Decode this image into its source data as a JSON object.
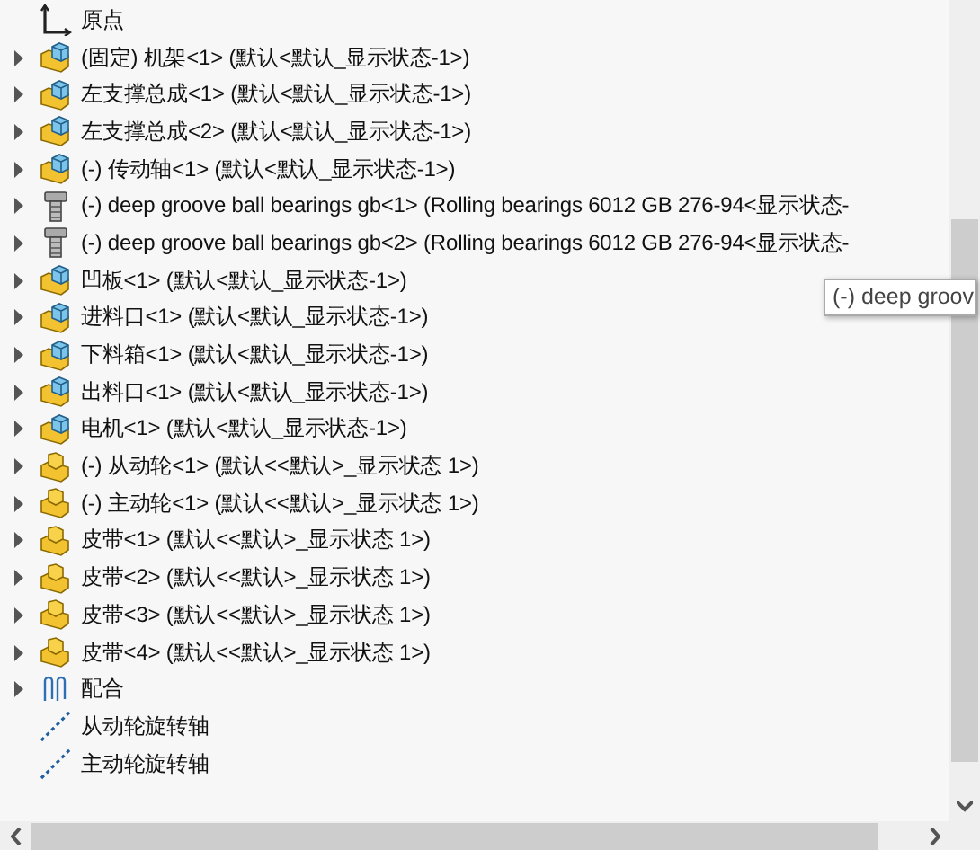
{
  "tree": [
    {
      "kind": "origin",
      "label": "原点"
    },
    {
      "kind": "subassembly",
      "label": "(固定) 机架<1> (默认<默认_显示状态-1>)",
      "expanded": false
    },
    {
      "kind": "subassembly",
      "label": "左支撑总成<1> (默认<默认_显示状态-1>)",
      "expanded": false
    },
    {
      "kind": "subassembly",
      "label": "左支撑总成<2> (默认<默认_显示状态-1>)",
      "expanded": false
    },
    {
      "kind": "subassembly",
      "label": "(-) 传动轴<1> (默认<默认_显示状态-1>)",
      "expanded": false
    },
    {
      "kind": "fastener",
      "label": "(-) deep groove ball bearings gb<1> (Rolling bearings 6012 GB 276-94<显示状态-",
      "expanded": false
    },
    {
      "kind": "fastener",
      "label": "(-) deep groove ball bearings gb<2> (Rolling bearings 6012 GB 276-94<显示状态-",
      "expanded": false
    },
    {
      "kind": "subassembly",
      "label": "凹板<1> (默认<默认_显示状态-1>)",
      "expanded": false
    },
    {
      "kind": "subassembly",
      "label": "进料口<1> (默认<默认_显示状态-1>)",
      "expanded": false
    },
    {
      "kind": "subassembly",
      "label": "下料箱<1> (默认<默认_显示状态-1>)",
      "expanded": false
    },
    {
      "kind": "subassembly",
      "label": "出料口<1> (默认<默认_显示状态-1>)",
      "expanded": false
    },
    {
      "kind": "subassembly",
      "label": "电机<1> (默认<默认_显示状态-1>)",
      "expanded": false
    },
    {
      "kind": "assembly",
      "label": "(-) 从动轮<1> (默认<<默认>_显示状态 1>)",
      "expanded": false
    },
    {
      "kind": "assembly",
      "label": "(-) 主动轮<1> (默认<<默认>_显示状态 1>)",
      "expanded": false
    },
    {
      "kind": "assembly",
      "label": "皮带<1> (默认<<默认>_显示状态 1>)",
      "expanded": false
    },
    {
      "kind": "assembly",
      "label": "皮带<2> (默认<<默认>_显示状态 1>)",
      "expanded": false
    },
    {
      "kind": "assembly",
      "label": "皮带<3> (默认<<默认>_显示状态 1>)",
      "expanded": false
    },
    {
      "kind": "assembly",
      "label": "皮带<4> (默认<<默认>_显示状态 1>)",
      "expanded": false
    },
    {
      "kind": "mates",
      "label": "配合",
      "expanded": false
    },
    {
      "kind": "axis",
      "label": "从动轮旋转轴"
    },
    {
      "kind": "axis",
      "label": "主动轮旋转轴"
    }
  ],
  "tooltip": {
    "text": "(-) deep groov"
  }
}
